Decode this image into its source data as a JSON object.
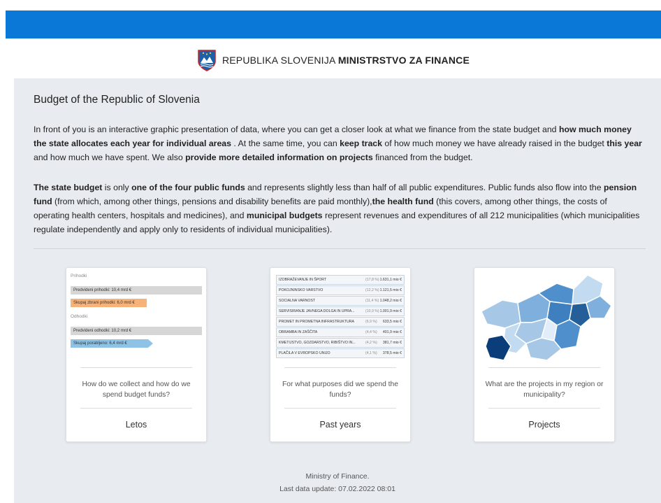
{
  "header": {
    "brand_light": "REPUBLIKA SLOVENIJA",
    "brand_bold": "MINISTRSTVO ZA FINANCE",
    "crest_icon": "slovenia-crest-icon",
    "topbar_color": "#0a78d7"
  },
  "intro": {
    "title": "Budget of the Republic of Slovenia",
    "p1": [
      "In front of you is an interactive graphic presentation of data, where you can get a closer look at what we finance from the state budget and ",
      "how much money the state allocates each year for individual areas",
      " . At the same time, you can ",
      "keep track",
      " of how much money we have already raised in the budget ",
      "this year",
      " and how much we have spent. We also ",
      "provide more detailed information on projects",
      " financed from the budget."
    ],
    "p2": [
      "The state budget",
      " is only ",
      "one of the four public funds",
      " and represents slightly less than half of all public expenditures. Public funds also flow into the ",
      "pension fund",
      " (from which, among other things, pensions and disability benefits are paid monthly),",
      "the health fund",
      " (this covers, among other things, the costs of operating health centers, hospitals and medicines), and ",
      "municipal budgets",
      " represent revenues and expenditures of all 212 municipalities (which municipalities regulate independently and apply only to residents of individual municipalities)."
    ]
  },
  "cards": [
    {
      "question": "How do we collect and how do we spend budget funds?",
      "label": "Letos",
      "preview": {
        "income_head": "Prihodki",
        "planned_income": "Predvideni prihodki: 10,4 mrd €",
        "collected_income": "Skupaj zbrani prihodki: 6,0 mrd €",
        "expense_head": "Odhodki",
        "planned_expense": "Predvideni odhodki: 10,2 mrd €",
        "spent_expense": "Skupaj porabljeno: 6,4 mrd €",
        "collected_share": 0.58,
        "spent_share": 0.63
      }
    },
    {
      "question": "For what purposes did we spend the funds?",
      "label": "Past years",
      "preview": {
        "rows": [
          {
            "name": "IZOBRAŽEVANJE IN ŠPORT",
            "pct": "(17,8 %)",
            "amount": "1.631,1 mio €"
          },
          {
            "name": "POKOJNINSKO VARSTVO",
            "pct": "(12,2 %)",
            "amount": "1.121,5 mio €"
          },
          {
            "name": "SOCIALNA VARNOST",
            "pct": "(11,4 %)",
            "amount": "1.048,2 mio €"
          },
          {
            "name": "SERVISIRANJE JAVNEGA DOLGA IN UPRA...",
            "pct": "(10,9 %)",
            "amount": "1.001,9 mio €"
          },
          {
            "name": "PROMET IN PROMETNA INFRASTRUKTURA",
            "pct": "(6,9 %)",
            "amount": "633,5 mio €"
          },
          {
            "name": "OBRAMBA IN ZAŠČITA",
            "pct": "(4,4 %)",
            "amount": "401,9 mio €"
          },
          {
            "name": "KMETIJSTVO, GOZDARSTVO, RIBIŠTVO IN...",
            "pct": "(4,2 %)",
            "amount": "381,7 mio €"
          },
          {
            "name": "PLAČILA V EVROPSKO UNIJO",
            "pct": "(4,1 %)",
            "amount": "378,5 mio €"
          }
        ]
      }
    },
    {
      "question": "What are the projects in my region or municipality?",
      "label": "Projects",
      "preview": {
        "map_icon": "slovenia-regions-map-icon"
      }
    }
  ],
  "footer": {
    "line1": "Ministry of Finance.",
    "line2": "Last data update: 07.02.2022 08:01"
  }
}
